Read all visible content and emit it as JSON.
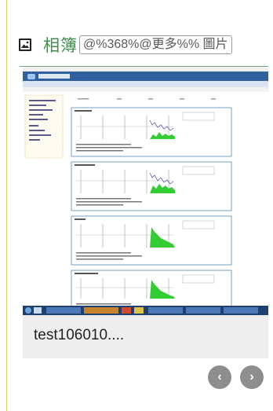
{
  "header": {
    "icon": "album-icon",
    "title": "相簿",
    "more_link": "@%368%@更多%% 圖片"
  },
  "photo": {
    "caption": "test106010....",
    "screenshot": {
      "titlebar_text": "Windows Internet Explorer",
      "panels": [
        {
          "label": "panel-1"
        },
        {
          "label": "panel-2"
        },
        {
          "label": "panel-3"
        },
        {
          "label": "panel-4"
        }
      ]
    }
  },
  "nav": {
    "prev_label": "‹",
    "next_label": "›"
  },
  "colors": {
    "title": "#3d8f49",
    "divider": "#6da777",
    "border": "#e3cc6e",
    "nav_button": "#8e8e8e",
    "card_bg": "#eeeeee"
  }
}
